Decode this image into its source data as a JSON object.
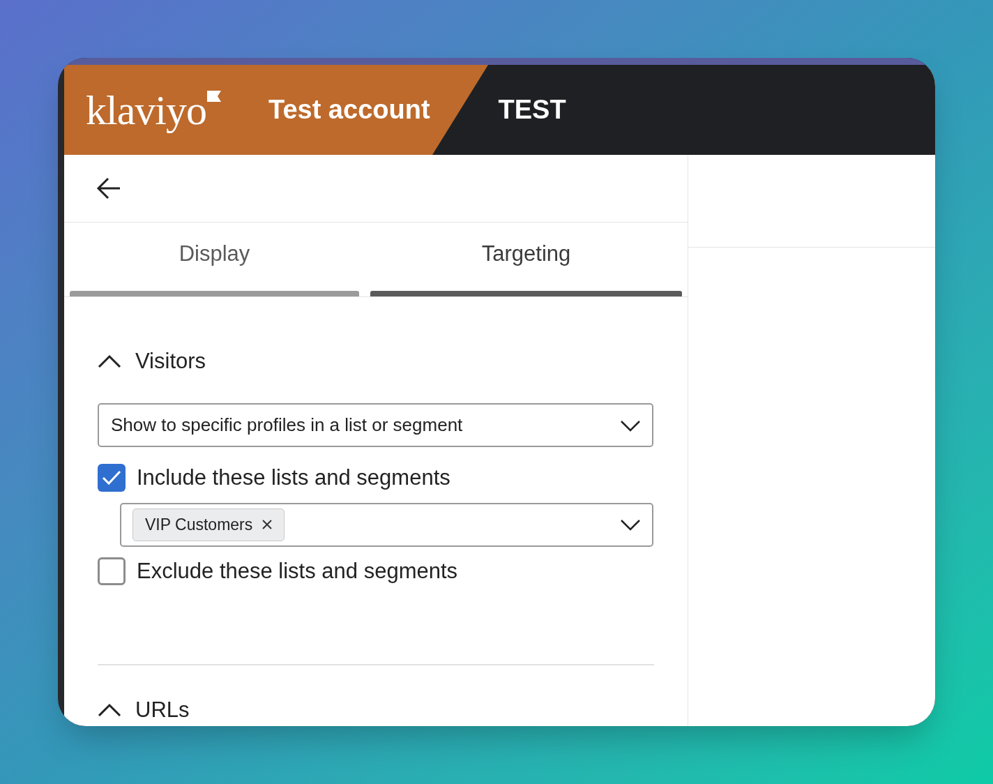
{
  "header": {
    "logo": "klaviyo",
    "account_name": "Test account",
    "environment_badge": "TEST"
  },
  "tabs": [
    {
      "label": "Display",
      "selected": false
    },
    {
      "label": "Targeting",
      "selected": true
    }
  ],
  "sections": [
    {
      "title": "Visitors",
      "expanded": true,
      "audience_select": {
        "value": "Show to specific profiles in a list or segment"
      },
      "options": [
        {
          "label": "Include these lists and segments",
          "checked": true,
          "tags": [
            "VIP Customers"
          ]
        },
        {
          "label": "Exclude these lists and segments",
          "checked": false
        }
      ]
    },
    {
      "title": "URLs",
      "expanded": true
    }
  ]
}
